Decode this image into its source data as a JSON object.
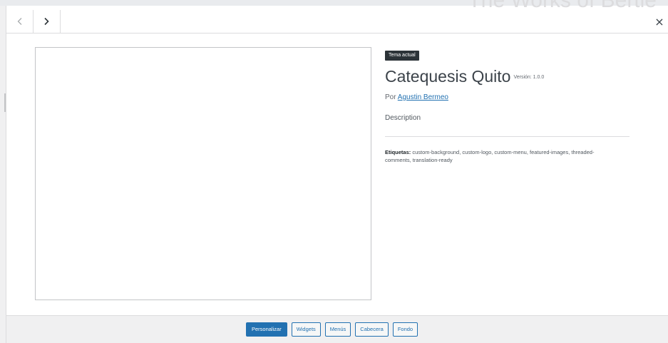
{
  "background": {
    "site_title": "The Works of Bertie"
  },
  "nav": {
    "prev_icon": "chevron-left",
    "next_icon": "chevron-right",
    "close_icon": "close-x",
    "close_glyph": "×"
  },
  "theme": {
    "badge": "Tema actual",
    "name": "Catequesis Quito",
    "version": "Versión: 1.0.0",
    "author_prefix": "Por",
    "author_name": "Agustin Bermeo",
    "description": "Description",
    "tags_label": "Etiquetas:",
    "tags": "custom-background, custom-logo, custom-menu, featured-images, threaded-comments, translation-ready"
  },
  "actions": {
    "customize": "Personalizar",
    "widgets": "Widgets",
    "menus": "Menús",
    "header": "Cabecera",
    "background": "Fondo"
  },
  "colors": {
    "primary": "#2271b1",
    "badge_bg": "#2c3338",
    "footer_bg": "#f0f0f1",
    "border": "#dcdcde"
  }
}
